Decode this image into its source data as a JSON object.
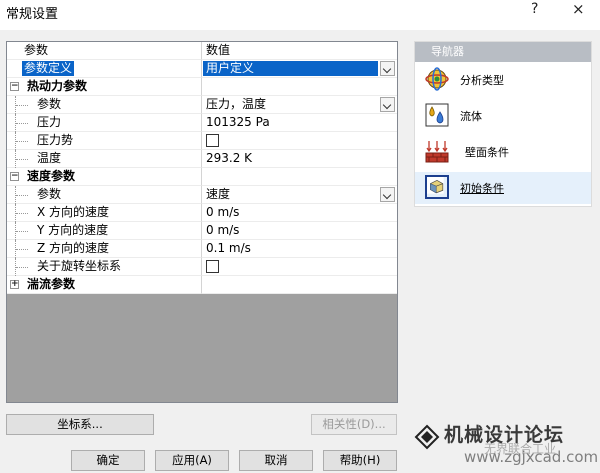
{
  "window": {
    "title": "常规设置",
    "help_glyph": "?",
    "close_glyph": "×"
  },
  "grid": {
    "header": {
      "name": "参数",
      "value": "数值"
    },
    "rows": [
      {
        "kind": "selected",
        "name": "参数定义",
        "value": "用户定义"
      },
      {
        "kind": "group",
        "name": "热动力参数",
        "expander": "⊟"
      },
      {
        "kind": "item",
        "name": "参数",
        "value": "压力，温度",
        "combo": true
      },
      {
        "kind": "item",
        "name": "压力",
        "value": "101325 Pa"
      },
      {
        "kind": "item",
        "name": "压力势",
        "checkbox": false
      },
      {
        "kind": "item",
        "name": "温度",
        "value": "293.2 K"
      },
      {
        "kind": "group",
        "name": "速度参数",
        "expander": "⊟"
      },
      {
        "kind": "item",
        "name": "参数",
        "value": "速度",
        "combo": true
      },
      {
        "kind": "item",
        "name": "X 方向的速度",
        "value": "0 m/s"
      },
      {
        "kind": "item",
        "name": "Y 方向的速度",
        "value": "0 m/s"
      },
      {
        "kind": "item",
        "name": "Z 方向的速度",
        "value": "0.1 m/s"
      },
      {
        "kind": "item",
        "name": "关于旋转坐标系",
        "checkbox": false
      },
      {
        "kind": "group",
        "name": "湍流参数",
        "expander": "⊞"
      }
    ]
  },
  "navigator": {
    "title": "导航器",
    "items": [
      {
        "label": "分析类型",
        "icon": "analysis-type-icon",
        "active": false
      },
      {
        "label": "流体",
        "icon": "fluid-icon",
        "active": false
      },
      {
        "label": "壁面条件",
        "icon": "wall-conditions-icon",
        "active": false
      },
      {
        "label": "初始条件",
        "icon": "initial-conditions-icon",
        "active": true
      }
    ]
  },
  "buttons": {
    "coordinate_system": "坐标系...",
    "dependency": "相关性(D)...",
    "ok": "确定",
    "apply": "应用(A)",
    "cancel": "取消",
    "help": "帮助(H)"
  },
  "watermark": {
    "title": "机械设计论坛",
    "url": "www.zgjxcad.com",
    "sub": "无界联合工业"
  }
}
